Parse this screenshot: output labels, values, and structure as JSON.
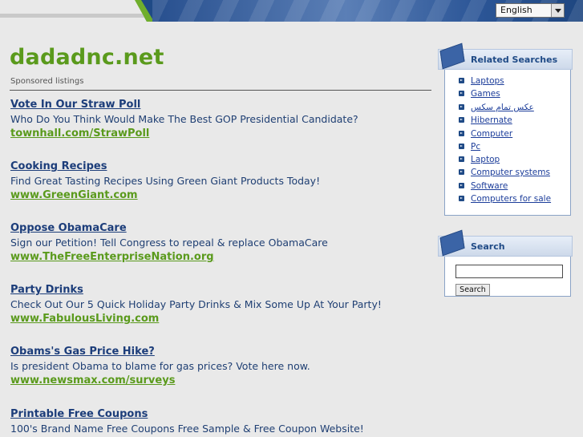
{
  "header": {
    "language": "English"
  },
  "site": {
    "title": "dadadnc.net",
    "sponsored_label": "Sponsored listings"
  },
  "listings": [
    {
      "title": "Vote In Our Straw Poll",
      "desc": "Who Do You Think Would Make The Best GOP Presidential Candidate?",
      "url": "townhall.com/StrawPoll"
    },
    {
      "title": "Cooking Recipes",
      "desc": "Find Great Tasting Recipes Using Green Giant Products Today!",
      "url": "www.GreenGiant.com"
    },
    {
      "title": "Oppose ObamaCare",
      "desc": "Sign our Petition! Tell Congress to repeal & replace ObamaCare",
      "url": "www.TheFreeEnterpriseNation.org"
    },
    {
      "title": "Party Drinks",
      "desc": "Check Out Our 5 Quick Holiday Party Drinks & Mix Some Up At Your Party!",
      "url": "www.FabulousLiving.com"
    },
    {
      "title": "Obams's Gas Price Hike?",
      "desc": "Is president Obama to blame for gas prices? Vote here now.",
      "url": "www.newsmax.com/surveys"
    },
    {
      "title": "Printable Free Coupons",
      "desc": "100's Brand Name Free Coupons Free Sample & Free Coupon Website!",
      "url": ""
    }
  ],
  "related": {
    "title": "Related Searches",
    "items": [
      "Laptops",
      "Games",
      "عکس تمام سکس",
      "Hibernate",
      "Computer",
      "Pc",
      "Laptop",
      "Computer systems",
      "Software",
      "Computers for sale"
    ]
  },
  "search": {
    "title": "Search",
    "input_value": "",
    "button_label": "Search"
  }
}
